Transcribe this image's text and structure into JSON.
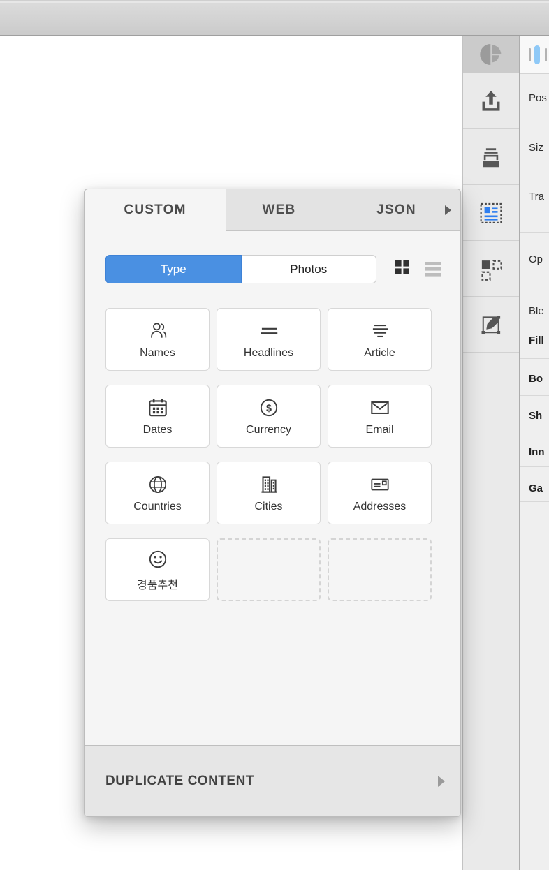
{
  "panel": {
    "tabs": [
      {
        "label": "CUSTOM",
        "active": true
      },
      {
        "label": "WEB",
        "active": false
      },
      {
        "label": "JSON",
        "active": false,
        "chevron_icon": "chevron-right-icon"
      }
    ],
    "segmented": {
      "type_label": "Type",
      "photos_label": "Photos",
      "selected": "Type"
    },
    "view_toggle": {
      "active": "grid",
      "icons": [
        "grid-view-icon",
        "list-view-icon"
      ]
    },
    "tiles": [
      {
        "label": "Names",
        "icon": "names-icon"
      },
      {
        "label": "Headlines",
        "icon": "headlines-icon"
      },
      {
        "label": "Article",
        "icon": "article-icon"
      },
      {
        "label": "Dates",
        "icon": "dates-icon"
      },
      {
        "label": "Currency",
        "icon": "currency-icon",
        "icon_glyph": "$"
      },
      {
        "label": "Email",
        "icon": "email-icon"
      },
      {
        "label": "Countries",
        "icon": "countries-icon"
      },
      {
        "label": "Cities",
        "icon": "cities-icon"
      },
      {
        "label": "Addresses",
        "icon": "addresses-icon"
      },
      {
        "label": "경품추천",
        "icon": "smiley-icon"
      }
    ],
    "placeholder_count": 2,
    "footer": {
      "label": "DUPLICATE CONTENT",
      "chevron_icon": "chevron-right-icon"
    }
  },
  "toolbar": {
    "items": [
      {
        "icon": "craft-logo-icon",
        "active": false
      },
      {
        "icon": "share-icon",
        "active": false
      },
      {
        "icon": "sync-icon",
        "active": false
      },
      {
        "icon": "data-content-icon",
        "active": true
      },
      {
        "icon": "duplicate-icon",
        "active": false
      },
      {
        "icon": "edit-icon",
        "active": false
      }
    ]
  },
  "inspector": {
    "rows": [
      {
        "text": "Pos",
        "bold": false
      },
      {
        "text": "Siz",
        "bold": false
      },
      {
        "text": "Tra",
        "bold": false
      },
      {
        "text": "Op",
        "bold": false
      },
      {
        "text": "Ble",
        "bold": false
      },
      {
        "text": "Fill",
        "bold": true
      },
      {
        "text": "Bo",
        "bold": true
      },
      {
        "text": "Sh",
        "bold": true
      },
      {
        "text": "Inn",
        "bold": true
      },
      {
        "text": "Ga",
        "bold": true
      }
    ]
  },
  "colors": {
    "accent_blue": "#4a90e2",
    "icon_blue": "#2f7ff0",
    "align_pill_blue": "#8fc9f7",
    "panel_bg": "#f5f5f5",
    "toolbar_bg": "#eaeaea"
  }
}
